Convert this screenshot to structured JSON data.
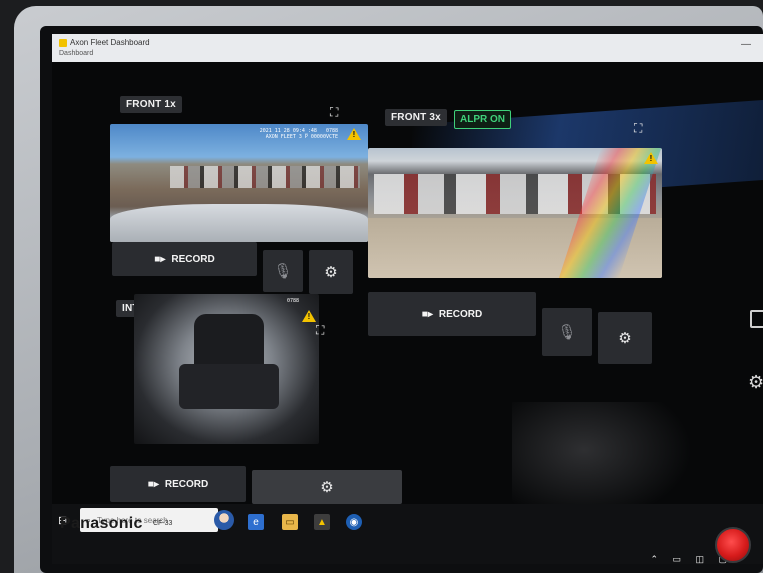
{
  "app": {
    "title": "Axon Fleet Dashboard",
    "subtitle": "Dashboard",
    "minimize_glyph": "—"
  },
  "cameras": [
    {
      "label": "FRONT 1x",
      "osd": "2021 11 28 09:4_:48   0788\nAXON FLEET 3 P 00000VCTE",
      "record_label": "RECORD",
      "mic_state": "off",
      "has_settings": true
    },
    {
      "label": "FRONT 3x",
      "alpr_badge": "ALPR ON",
      "record_label": "RECORD",
      "mic_state": "off",
      "has_settings": true
    },
    {
      "label": "INTERIOR",
      "osd": "0788",
      "record_label": "RECORD",
      "has_settings": true
    }
  ],
  "taskbar": {
    "search_placeholder": "Type here to search"
  },
  "device": {
    "brand": "Panasonic",
    "model": "CF-33"
  },
  "icons": {
    "record": "video-camera-icon",
    "mic": "microphone-icon",
    "settings": "gear-icon",
    "expand": "fullscreen-icon",
    "warning": "warning-triangle-icon"
  },
  "colors": {
    "alpr_green": "#3fd17a",
    "warning_yellow": "#f3c300",
    "button_bg": "#2a2c30",
    "record_red": "#d61b1b"
  }
}
